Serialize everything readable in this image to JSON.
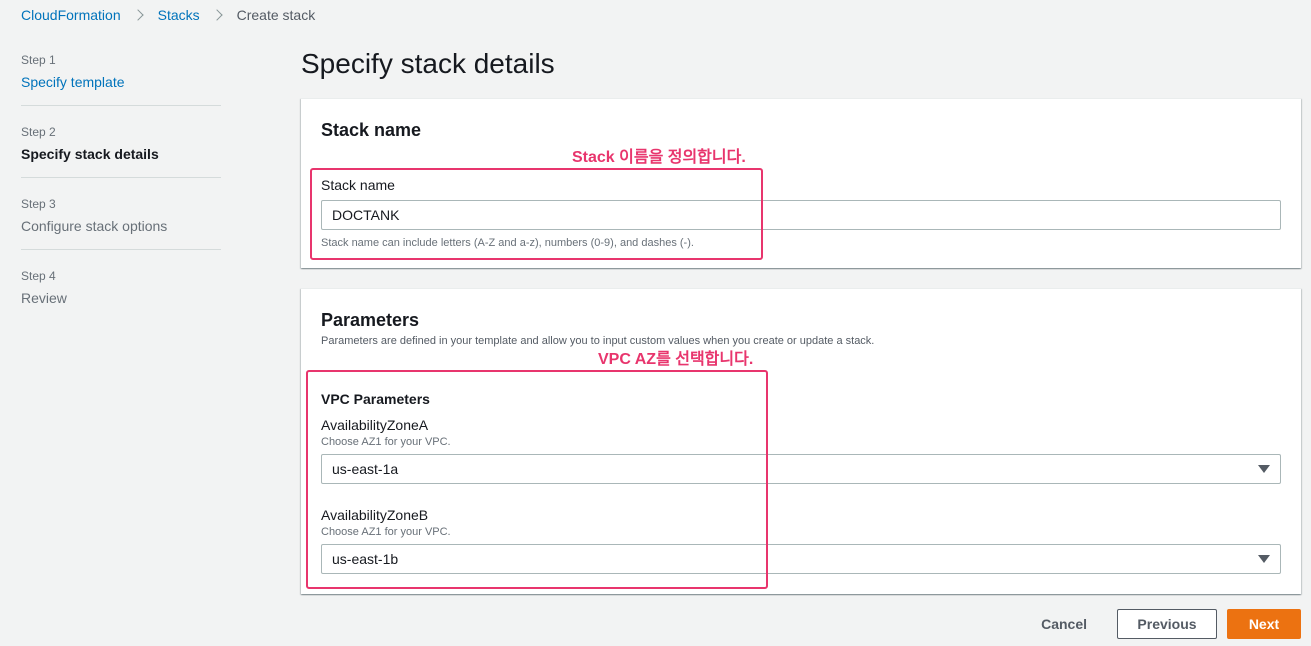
{
  "breadcrumb": {
    "items": [
      "CloudFormation",
      "Stacks"
    ],
    "current": "Create stack"
  },
  "steps": [
    {
      "num": "Step 1",
      "title": "Specify template"
    },
    {
      "num": "Step 2",
      "title": "Specify stack details"
    },
    {
      "num": "Step 3",
      "title": "Configure stack options"
    },
    {
      "num": "Step 4",
      "title": "Review"
    }
  ],
  "page_title": "Specify stack details",
  "stack_panel": {
    "title": "Stack name",
    "field_label": "Stack name",
    "value": "DOCTANK",
    "hint": "Stack name can include letters (A-Z and a-z), numbers (0-9), and dashes (-)."
  },
  "params_panel": {
    "title": "Parameters",
    "description": "Parameters are defined in your template and allow you to input custom values when you create or update a stack.",
    "group_title": "VPC Parameters",
    "az_a": {
      "label": "AvailabilityZoneA",
      "desc": "Choose AZ1 for your VPC.",
      "value": "us-east-1a"
    },
    "az_b": {
      "label": "AvailabilityZoneB",
      "desc": "Choose AZ1 for your VPC.",
      "value": "us-east-1b"
    }
  },
  "annotations": {
    "stack": "Stack 이름을 정의합니다.",
    "vpc": "VPC AZ를 선택합니다."
  },
  "footer": {
    "cancel": "Cancel",
    "previous": "Previous",
    "next": "Next"
  },
  "colors": {
    "link": "#0073bb",
    "primary_button": "#ec7211",
    "annotation": "#e8356d",
    "background": "#f2f3f3"
  }
}
